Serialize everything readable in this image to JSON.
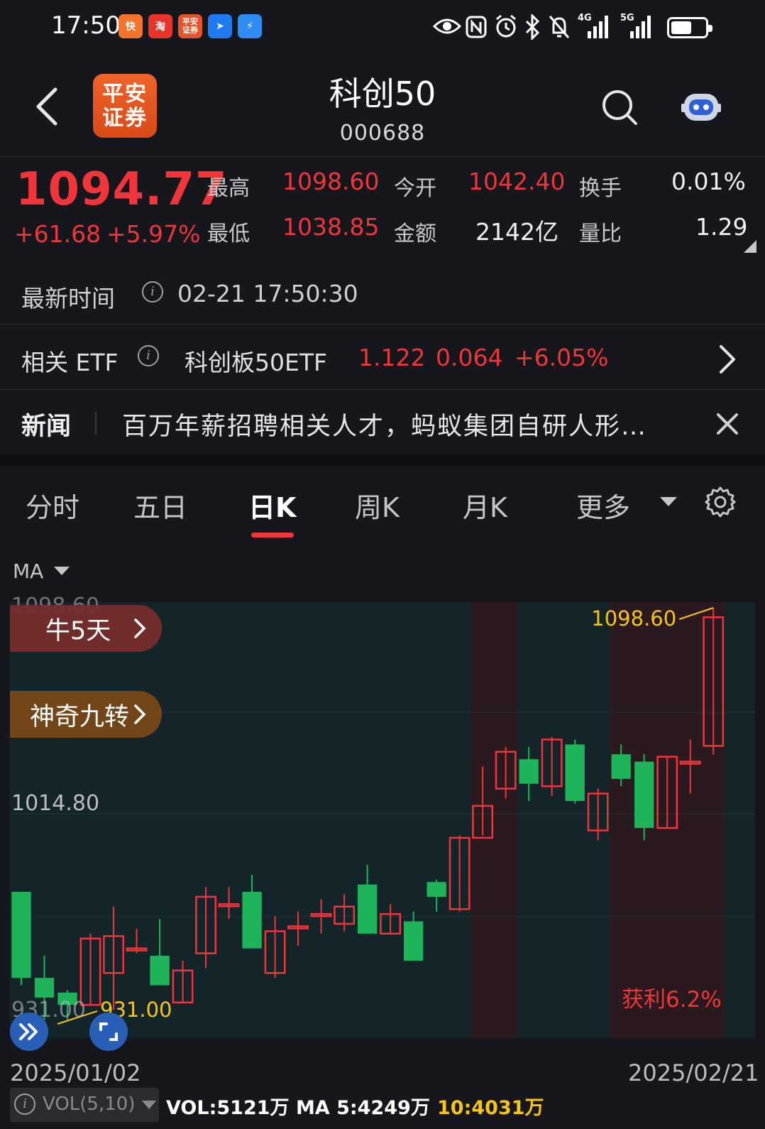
{
  "status_bar": {
    "time": "17:50",
    "app_icons": [
      {
        "name": "kuaishou",
        "label": "快",
        "color": "#f5732a"
      },
      {
        "name": "taobao",
        "label": "淘",
        "color": "#e8342a"
      },
      {
        "name": "pingan-securities",
        "label": "平安",
        "color": "#e8542a"
      },
      {
        "name": "navigation",
        "label": "➤",
        "color": "#1f7bf2"
      },
      {
        "name": "flash",
        "label": "⚡",
        "color": "#2f8cf5"
      }
    ],
    "system_icons": [
      "eye-icon",
      "nfc-icon",
      "alarm-icon",
      "bluetooth-icon",
      "mute-icon",
      "signal-4g-icon",
      "signal-5g-icon"
    ],
    "network_4g": "4G",
    "network_5g": "5G"
  },
  "header": {
    "broker_logo_line1": "平安",
    "broker_logo_line2": "证券",
    "title": "科创50",
    "code": "000688"
  },
  "quote": {
    "price": "1094.77",
    "change": "+61.68",
    "change_pct": "+5.97%",
    "high_label": "最高",
    "high": "1098.60",
    "open_label": "今开",
    "open": "1042.40",
    "turnover_label": "换手",
    "turnover": "0.01%",
    "low_label": "最低",
    "low": "1038.85",
    "amount_label": "金额",
    "amount": "2142亿",
    "volume_ratio_label": "量比",
    "volume_ratio": "1.29"
  },
  "latest_time": {
    "label": "最新时间",
    "value": "02-21 17:50:30"
  },
  "etf": {
    "label": "相关 ETF",
    "name": "科创板50ETF",
    "price": "1.122",
    "change": "0.064",
    "change_pct": "+6.05%"
  },
  "news": {
    "label": "新闻",
    "headline": "百万年薪招聘相关人才，蚂蚁集团自研人形…"
  },
  "tabs": [
    {
      "label": "分时",
      "active": false
    },
    {
      "label": "五日",
      "active": false
    },
    {
      "label": "日K",
      "active": true
    },
    {
      "label": "周K",
      "active": false
    },
    {
      "label": "月K",
      "active": false
    },
    {
      "label": "更多",
      "active": false
    }
  ],
  "indicator": {
    "main": "MA"
  },
  "signals": {
    "bull_days": "牛5天",
    "magic_nine": "神奇九转",
    "profit": "获利6.2%"
  },
  "chart_axis": {
    "top": "1098.60",
    "mid": "1014.80",
    "bottom": "931.00",
    "start_date": "2025/01/02",
    "end_date": "2025/02/21"
  },
  "chart_data": {
    "type": "candlestick",
    "x": [
      "2025/01/02",
      "2025/02/21"
    ],
    "ylim": [
      931.0,
      1098.6
    ],
    "max_label": "1098.60",
    "min_label": "931.00",
    "up_color": "#f0353b",
    "down_color": "#1fb35a",
    "candles": [
      {
        "o": 983.0,
        "c": 948.0,
        "h": 983.0,
        "l": 945.0
      },
      {
        "o": 948.0,
        "c": 940.0,
        "h": 957.0,
        "l": 931.0
      },
      {
        "o": 942.0,
        "c": 937.0,
        "h": 943.0,
        "l": 931.0
      },
      {
        "o": 937.0,
        "c": 964.0,
        "h": 966.0,
        "l": 937.0
      },
      {
        "o": 950.0,
        "c": 965.0,
        "h": 977.0,
        "l": 935.0
      },
      {
        "o": 960.0,
        "c": 960.0,
        "h": 968.0,
        "l": 958.0
      },
      {
        "o": 957.0,
        "c": 945.0,
        "h": 972.0,
        "l": 945.0
      },
      {
        "o": 938.0,
        "c": 951.0,
        "h": 955.0,
        "l": 938.0
      },
      {
        "o": 958.0,
        "c": 981.0,
        "h": 985.0,
        "l": 952.0
      },
      {
        "o": 978.0,
        "c": 978.0,
        "h": 985.0,
        "l": 972.0
      },
      {
        "o": 983.0,
        "c": 960.0,
        "h": 990.0,
        "l": 960.0
      },
      {
        "o": 950.0,
        "c": 967.0,
        "h": 973.0,
        "l": 948.0
      },
      {
        "o": 969.0,
        "c": 969.0,
        "h": 975.0,
        "l": 961.0
      },
      {
        "o": 974.0,
        "c": 974.0,
        "h": 980.0,
        "l": 966.0
      },
      {
        "o": 970.0,
        "c": 977.0,
        "h": 982.0,
        "l": 967.0
      },
      {
        "o": 986.0,
        "c": 966.0,
        "h": 994.0,
        "l": 966.0
      },
      {
        "o": 966.0,
        "c": 974.0,
        "h": 978.0,
        "l": 966.0
      },
      {
        "o": 971.0,
        "c": 955.0,
        "h": 975.0,
        "l": 955.0
      },
      {
        "o": 987.0,
        "c": 981.0,
        "h": 988.0,
        "l": 975.0
      },
      {
        "o": 976.0,
        "c": 1005.0,
        "h": 1006.0,
        "l": 975.0
      },
      {
        "o": 1005.0,
        "c": 1018.0,
        "h": 1034.0,
        "l": 1006.0
      },
      {
        "o": 1025.0,
        "c": 1040.0,
        "h": 1042.0,
        "l": 1021.0
      },
      {
        "o": 1037.0,
        "c": 1027.0,
        "h": 1042.0,
        "l": 1020.0
      },
      {
        "o": 1026.0,
        "c": 1045.0,
        "h": 1046.0,
        "l": 1022.0
      },
      {
        "o": 1043.0,
        "c": 1020.0,
        "h": 1045.0,
        "l": 1019.0
      },
      {
        "o": 1008.0,
        "c": 1023.0,
        "h": 1025.0,
        "l": 1004.0
      },
      {
        "o": 1039.0,
        "c": 1029.0,
        "h": 1043.0,
        "l": 1026.0
      },
      {
        "o": 1036.0,
        "c": 1009.0,
        "h": 1039.0,
        "l": 1004.0
      },
      {
        "o": 1009.0,
        "c": 1038.0,
        "h": 1038.0,
        "l": 1009.0
      },
      {
        "o": 1036.0,
        "c": 1036.0,
        "h": 1045.0,
        "l": 1023.0
      },
      {
        "o": 1042.4,
        "c": 1094.77,
        "h": 1098.6,
        "l": 1038.85
      }
    ],
    "highlight_ranges": [
      [
        20,
        21
      ],
      [
        26,
        30
      ]
    ]
  },
  "volume": {
    "indicator": "VOL(5,10)",
    "vol": "VOL:5121万",
    "ma5": "MA 5:4249万",
    "ma10": "10:4031万"
  }
}
